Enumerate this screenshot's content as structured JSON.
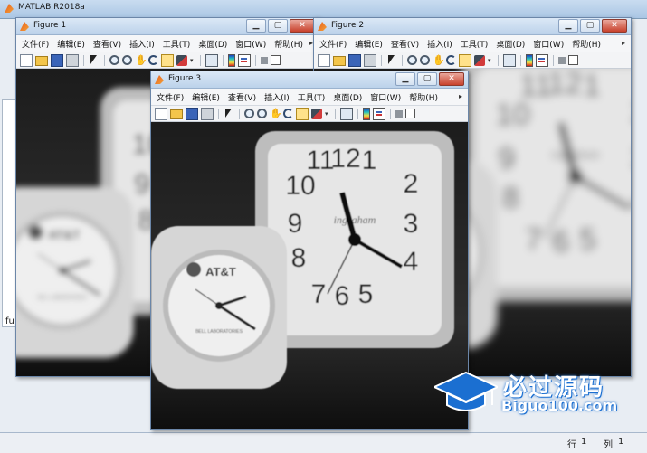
{
  "main": {
    "title": "MATLAB R2018a",
    "left_peek_text": "fu",
    "status": {
      "row_label": "行",
      "row_value": "1",
      "col_label": "列",
      "col_value": "1"
    }
  },
  "figures": [
    {
      "id": "fig1",
      "title": "Figure 1"
    },
    {
      "id": "fig2",
      "title": "Figure 2"
    },
    {
      "id": "fig3",
      "title": "Figure 3"
    }
  ],
  "menu": [
    "文件(F)",
    "编辑(E)",
    "查看(V)",
    "插入(I)",
    "工具(T)",
    "桌面(D)",
    "窗口(W)",
    "帮助(H)"
  ],
  "toolbar_icons": [
    "new-figure-icon",
    "open-file-icon",
    "save-icon",
    "print-icon",
    "edit-plot-arrow-icon",
    "zoom-in-icon",
    "zoom-out-icon",
    "pan-icon",
    "rotate-3d-icon",
    "data-cursor-icon",
    "brush-icon",
    "link-plot-icon",
    "colorbar-icon",
    "legend-icon",
    "hide-plot-tools-icon",
    "show-plot-tools-icon"
  ],
  "clock_labels": {
    "big_numbers": [
      "11",
      "12",
      "1",
      "2",
      "10",
      "3",
      "9",
      "4",
      "8",
      "7",
      "6",
      "5"
    ],
    "brand_small": "AT&T",
    "brand_small_sub": "BELL LABORATORIES",
    "brand_big": "ingraham"
  },
  "watermark": {
    "cn": "必过源码",
    "en": "Biguo100.com"
  },
  "colors": {
    "titlebar": "#bcd2ea",
    "close_button": "#c8412c",
    "watermark_blue": "#1b6fd1"
  }
}
